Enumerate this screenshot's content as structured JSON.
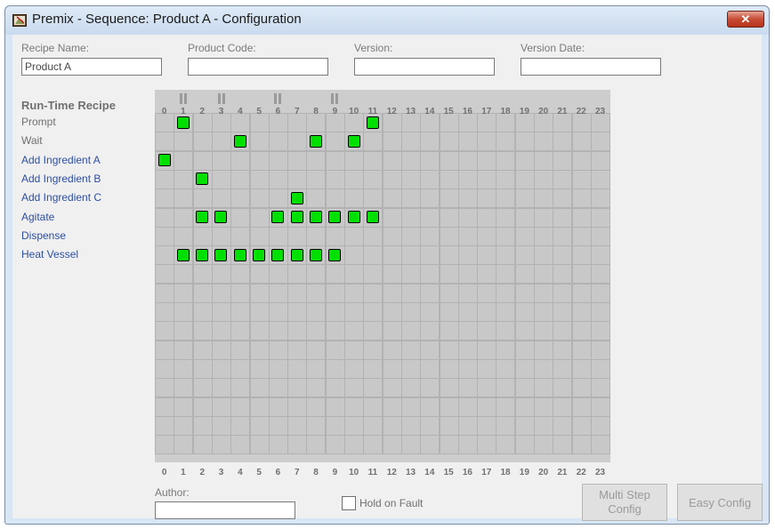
{
  "window": {
    "title": "Premix - Sequence: Product A - Configuration",
    "close_glyph": "✕"
  },
  "fields": {
    "recipe_name_label": "Recipe Name:",
    "recipe_name_value": "Product A",
    "product_code_label": "Product Code:",
    "product_code_value": "",
    "version_label": "Version:",
    "version_value": "",
    "version_date_label": "Version Date:",
    "version_date_value": "",
    "author_label": "Author:",
    "author_value": ""
  },
  "recipe": {
    "section_title": "Run-Time Recipe",
    "rows": [
      {
        "label": "Prompt",
        "steps": [
          1,
          11
        ]
      },
      {
        "label": "Wait",
        "steps": [
          4,
          8,
          10
        ]
      },
      {
        "label": "Add Ingredient A",
        "steps": [
          0
        ]
      },
      {
        "label": "Add Ingredient B",
        "steps": [
          2
        ]
      },
      {
        "label": "Add Ingredient C",
        "steps": [
          7
        ]
      },
      {
        "label": "Agitate",
        "steps": [
          2,
          3,
          6,
          7,
          8,
          9,
          10,
          11
        ]
      },
      {
        "label": "Dispense",
        "steps": []
      },
      {
        "label": "Heat Vessel",
        "steps": [
          1,
          2,
          3,
          4,
          5,
          6,
          7,
          8,
          9
        ]
      }
    ],
    "columns": [
      "0",
      "1",
      "2",
      "3",
      "4",
      "5",
      "6",
      "7",
      "8",
      "9",
      "10",
      "11",
      "12",
      "13",
      "14",
      "15",
      "16",
      "17",
      "18",
      "19",
      "20",
      "21",
      "22",
      "23"
    ],
    "pause_columns": [
      1,
      3,
      6,
      9
    ],
    "total_rows": 18
  },
  "options": {
    "hold_on_fault_label": "Hold on Fault",
    "hold_on_fault_checked": false
  },
  "buttons": {
    "multi_step_line1": "Multi Step",
    "multi_step_line2": "Config",
    "easy_config": "Easy Config"
  },
  "colors": {
    "step_fill": "#00e000",
    "label_blue": "#2d4fa0",
    "label_gray": "#707070"
  }
}
